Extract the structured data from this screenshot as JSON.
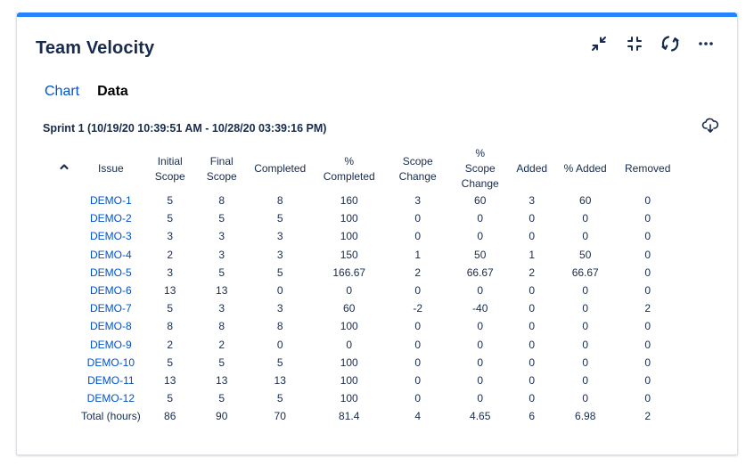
{
  "widget": {
    "title": "Team Velocity",
    "accent_color": "#2684ff",
    "actions": [
      {
        "name": "collapse-icon"
      },
      {
        "name": "minimize-icon"
      },
      {
        "name": "refresh-icon"
      },
      {
        "name": "more-icon"
      }
    ]
  },
  "tabs": [
    {
      "label": "Chart",
      "active": false
    },
    {
      "label": "Data",
      "active": true
    }
  ],
  "sprint": {
    "label": "Sprint 1 (10/19/20 10:39:51 AM - 10/28/20 03:39:16 PM)",
    "download_icon": "cloud-download-icon"
  },
  "table": {
    "sort_icon": "chevron-up-icon",
    "headers": [
      "Issue",
      "Initial Scope",
      "Final Scope",
      "Completed",
      "% Completed",
      "Scope Change",
      "% Scope Change",
      "Added",
      "% Added",
      "Removed"
    ],
    "rows": [
      [
        "DEMO-1",
        "5",
        "8",
        "8",
        "160",
        "3",
        "60",
        "3",
        "60",
        "0"
      ],
      [
        "DEMO-2",
        "5",
        "5",
        "5",
        "100",
        "0",
        "0",
        "0",
        "0",
        "0"
      ],
      [
        "DEMO-3",
        "3",
        "3",
        "3",
        "100",
        "0",
        "0",
        "0",
        "0",
        "0"
      ],
      [
        "DEMO-4",
        "2",
        "3",
        "3",
        "150",
        "1",
        "50",
        "1",
        "50",
        "0"
      ],
      [
        "DEMO-5",
        "3",
        "5",
        "5",
        "166.67",
        "2",
        "66.67",
        "2",
        "66.67",
        "0"
      ],
      [
        "DEMO-6",
        "13",
        "13",
        "0",
        "0",
        "0",
        "0",
        "0",
        "0",
        "0"
      ],
      [
        "DEMO-7",
        "5",
        "3",
        "3",
        "60",
        "-2",
        "-40",
        "0",
        "0",
        "2"
      ],
      [
        "DEMO-8",
        "8",
        "8",
        "8",
        "100",
        "0",
        "0",
        "0",
        "0",
        "0"
      ],
      [
        "DEMO-9",
        "2",
        "2",
        "0",
        "0",
        "0",
        "0",
        "0",
        "0",
        "0"
      ],
      [
        "DEMO-10",
        "5",
        "5",
        "5",
        "100",
        "0",
        "0",
        "0",
        "0",
        "0"
      ],
      [
        "DEMO-11",
        "13",
        "13",
        "13",
        "100",
        "0",
        "0",
        "0",
        "0",
        "0"
      ],
      [
        "DEMO-12",
        "5",
        "5",
        "5",
        "100",
        "0",
        "0",
        "0",
        "0",
        "0"
      ]
    ],
    "total": [
      "Total (hours)",
      "86",
      "90",
      "70",
      "81.4",
      "4",
      "4.65",
      "6",
      "6.98",
      "2"
    ]
  }
}
